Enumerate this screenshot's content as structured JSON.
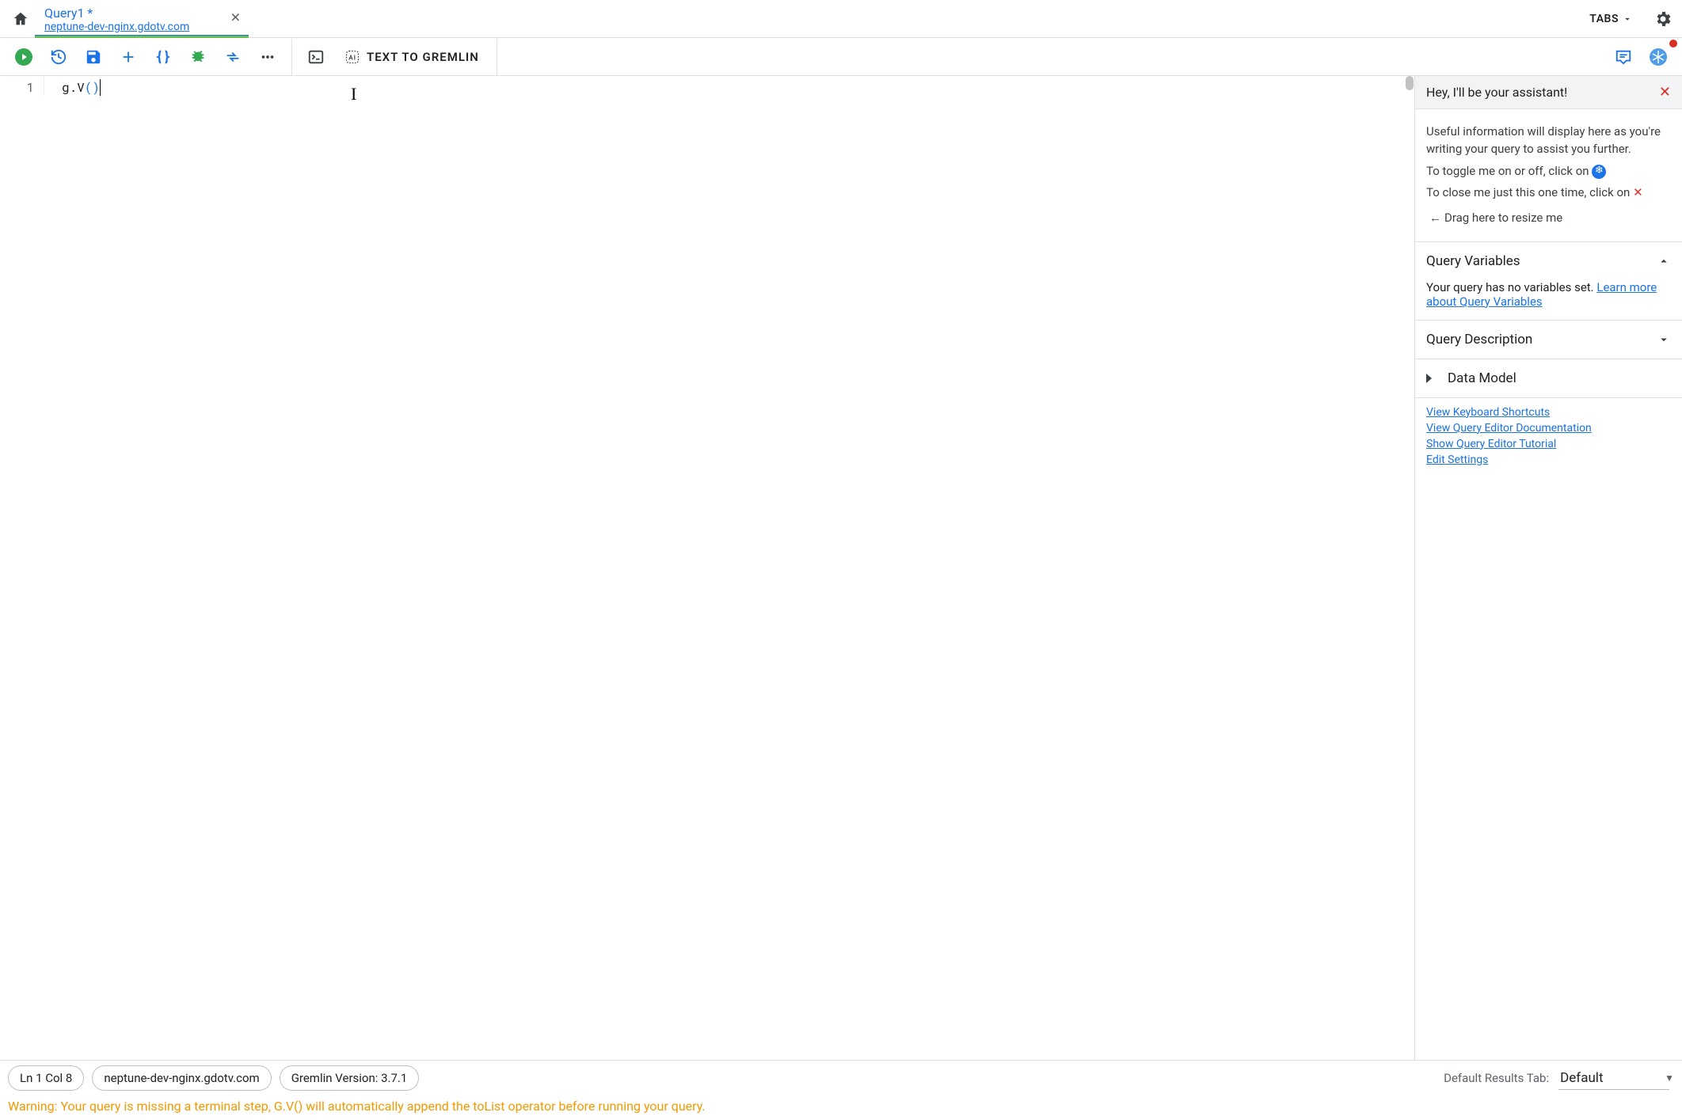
{
  "tabbar": {
    "tabs_label": "TABS",
    "tab": {
      "title": "Query1 *",
      "subtitle": "neptune-dev-nginx.gdotv.com"
    }
  },
  "toolbar": {
    "text_to_gremlin": "TEXT TO GREMLIN"
  },
  "editor": {
    "line_numbers": [
      "1"
    ],
    "code_plain": "g.V",
    "code_paren_open": "(",
    "code_paren_close": ")"
  },
  "assistant": {
    "greeting": "Hey, I'll be your assistant!",
    "info": "Useful information will display here as you're writing your query to assist you further.",
    "toggle_text": "To toggle me on or off, click on",
    "close_text": "To close me just this one time, click on",
    "drag_text": "Drag here to resize me",
    "sections": {
      "query_variables": {
        "title": "Query Variables",
        "body_prefix": "Your query has no variables set. ",
        "link": "Learn more about Query Variables"
      },
      "query_description": {
        "title": "Query Description"
      },
      "data_model": {
        "title": "Data Model"
      }
    },
    "links": [
      "View Keyboard Shortcuts",
      "View Query Editor Documentation",
      "Show Query Editor Tutorial",
      "Edit Settings"
    ]
  },
  "status": {
    "position": "Ln 1 Col 8",
    "host": "neptune-dev-nginx.gdotv.com",
    "gremlin_version": "Gremlin Version: 3.7.1",
    "default_results_label": "Default Results Tab:",
    "default_results_value": "Default",
    "warning": "Warning: Your query is missing a terminal step, G.V() will automatically append the toList operator before running your query."
  }
}
